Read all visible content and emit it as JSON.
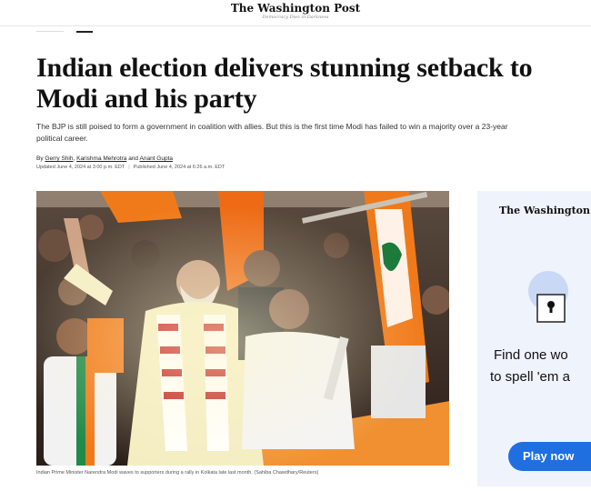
{
  "masthead": {
    "logo": "The Washington Post",
    "tagline": "Democracy Dies in Darkness"
  },
  "article": {
    "headline": "Indian election delivers stunning setback to Modi and his party",
    "dek": "The BJP is still poised to form a government in coalition with allies. But this is the first time Modi has failed to win a majority over a 23-year political career.",
    "byline_prefix": "By",
    "authors": [
      "Gerry Shih",
      "Karishma Mehrotra",
      "Anant Gupta"
    ],
    "author_sep1": ",",
    "author_sep2": "and",
    "updated": "Updated June 4, 2024 at 3:00 p.m. EDT",
    "published": "Published June 4, 2024 at 6:26 a.m. EDT",
    "caption": "Indian Prime Minister Narendra Modi waves to supporters during a rally in Kolkata late last month. (Sahiba Chawdhary/Reuters)"
  },
  "ad": {
    "logo": "The Washington Post",
    "line1": "Find one wo",
    "line2": "to spell 'em a",
    "button": "Play now"
  },
  "colors": {
    "accent": "#1f6fe0",
    "ad_bg": "#eef3fc",
    "saffron": "#f07a1a"
  }
}
